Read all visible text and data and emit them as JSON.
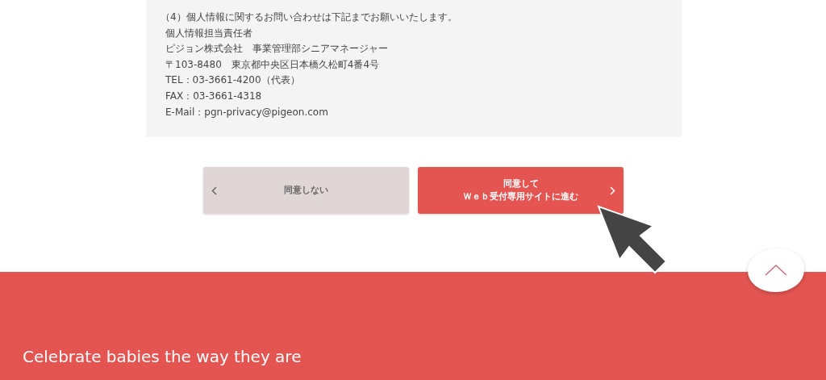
{
  "contact_box": {
    "heading": "（4）個人情報に関するお問い合わせは下記までお願いいたします。",
    "lines": [
      "個人情報担当責任者",
      "ピジョン株式会社　事業管理部シニアマネージャー",
      "〒103-8480　東京都中央区日本橋久松町4番4号",
      "TEL：03-3661-4200（代表）",
      "FAX：03-3661-4318",
      "E-Mail：pgn-privacy@pigeon.com"
    ]
  },
  "buttons": [
    {
      "kind": "back",
      "lines": [
        "同意しない"
      ]
    },
    {
      "kind": "forward",
      "lines": [
        "同意して",
        "Ｗｅｂ受付専用サイトに進む"
      ]
    }
  ],
  "footer": {
    "tagline": "Celebrate babies the way they are"
  }
}
